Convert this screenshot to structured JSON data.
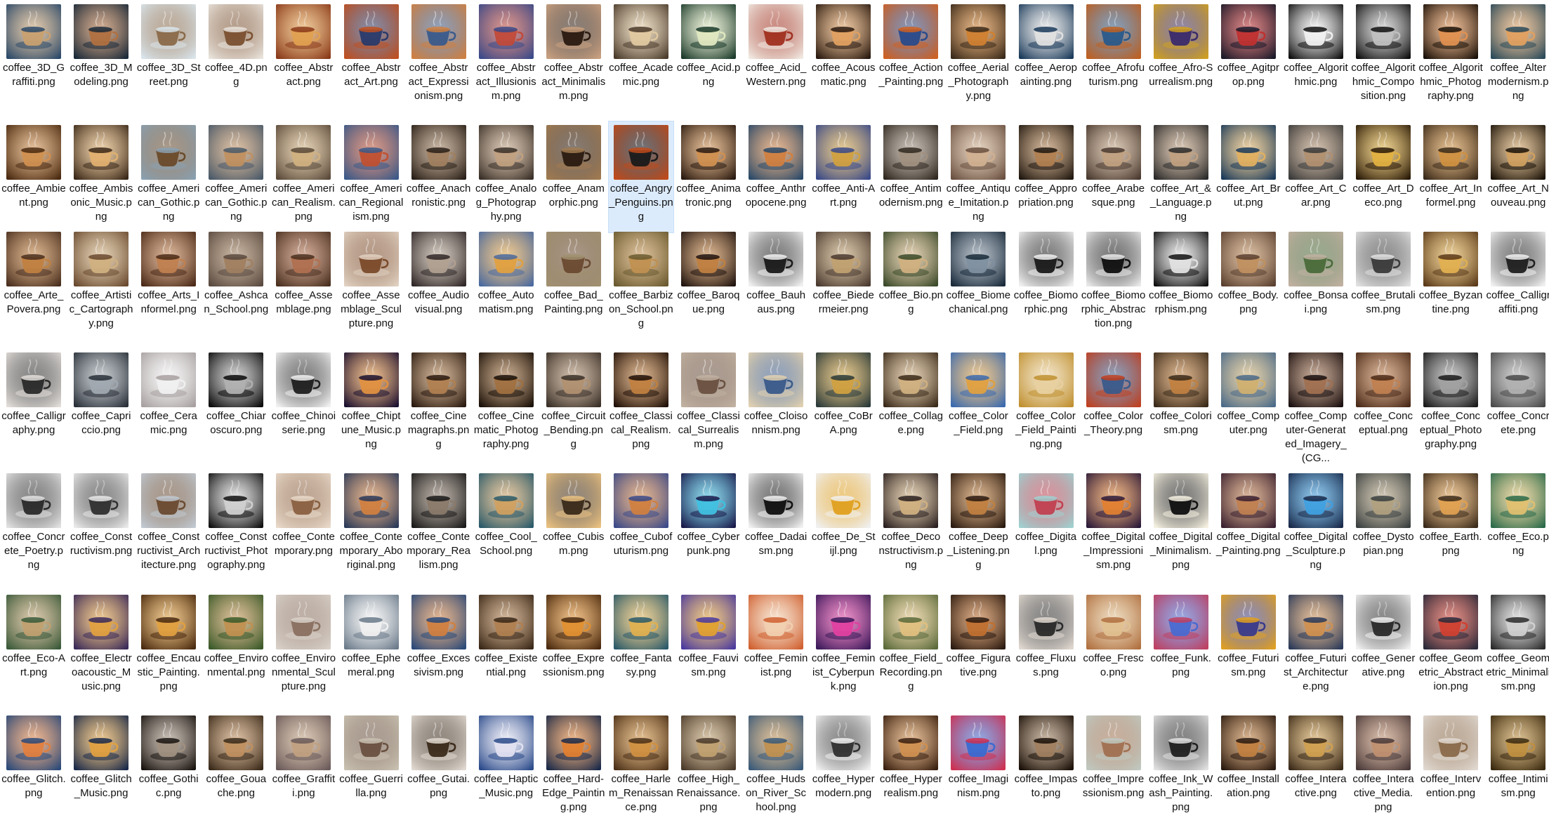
{
  "files": [
    {
      "name": "coffee_3D_Graffiti.png",
      "colors": [
        "#2b4a6a",
        "#c8a070"
      ]
    },
    {
      "name": "coffee_3D_Modeling.png",
      "colors": [
        "#1a2a3a",
        "#b07040"
      ]
    },
    {
      "name": "coffee_3D_Street.png",
      "colors": [
        "#d9e4ea",
        "#8a6a4a"
      ]
    },
    {
      "name": "coffee_4D.png",
      "colors": [
        "#e8e2da",
        "#7a5030"
      ]
    },
    {
      "name": "coffee_Abstract.png",
      "colors": [
        "#8a3a1a",
        "#e0a050"
      ]
    },
    {
      "name": "coffee_Abstract_Art.png",
      "colors": [
        "#c05020",
        "#2a3a6a"
      ]
    },
    {
      "name": "coffee_Abstract_Expressionism.png",
      "colors": [
        "#d08040",
        "#3a5a8a"
      ]
    },
    {
      "name": "coffee_Abstract_Illusionism.png",
      "colors": [
        "#3a4a8a",
        "#c04a3a"
      ]
    },
    {
      "name": "coffee_Abstract_Minimalism.png",
      "colors": [
        "#c8a080",
        "#2a1a10"
      ]
    },
    {
      "name": "coffee_Academic.png",
      "colors": [
        "#4a3a2a",
        "#e0c8a0"
      ]
    },
    {
      "name": "coffee_Acid.png",
      "colors": [
        "#1a3a2a",
        "#e0e8c0"
      ]
    },
    {
      "name": "coffee_Acid_Western.png",
      "colors": [
        "#f0e8e0",
        "#a03020"
      ]
    },
    {
      "name": "coffee_Acousmatic.png",
      "colors": [
        "#2a1a10",
        "#e0a060"
      ]
    },
    {
      "name": "coffee_Action_Painting.png",
      "colors": [
        "#d06020",
        "#2a4a8a"
      ]
    },
    {
      "name": "coffee_Aerial_Photography.png",
      "colors": [
        "#3a2a1a",
        "#d08030"
      ]
    },
    {
      "name": "coffee_Aeropainting.png",
      "colors": [
        "#1a3a5a",
        "#e0e0e0"
      ]
    },
    {
      "name": "coffee_Afrofuturism.png",
      "colors": [
        "#c06020",
        "#2a5a8a"
      ]
    },
    {
      "name": "coffee_Afro-Surrealism.png",
      "colors": [
        "#d0a020",
        "#3a2a6a"
      ]
    },
    {
      "name": "coffee_Agitprop.png",
      "colors": [
        "#1a1a2a",
        "#c03030"
      ]
    },
    {
      "name": "coffee_Algorithmic.png",
      "colors": [
        "#101010",
        "#f0f0f0"
      ]
    },
    {
      "name": "coffee_Algorithmic_Composition.png",
      "colors": [
        "#101010",
        "#c0c0c0"
      ]
    },
    {
      "name": "coffee_Algorithmic_Photography.png",
      "colors": [
        "#1a1008",
        "#e09050"
      ]
    },
    {
      "name": "coffee_Altermodernism.png",
      "colors": [
        "#2a4a5a",
        "#e0a060"
      ]
    },
    {
      "name": "coffee_Ambient.png",
      "colors": [
        "#4a2a10",
        "#d09050"
      ]
    },
    {
      "name": "coffee_Ambisonic_Music.png",
      "colors": [
        "#3a2818",
        "#e0b070"
      ]
    },
    {
      "name": "coffee_American_Gothic.png",
      "colors": [
        "#8aa0b0",
        "#6a4a2a"
      ]
    },
    {
      "name": "coffee_American_Gothic.png",
      "colors": [
        "#4a5a6a",
        "#c09060"
      ]
    },
    {
      "name": "coffee_American_Realism.png",
      "colors": [
        "#5a4a3a",
        "#d0b080"
      ]
    },
    {
      "name": "coffee_American_Regionalism.png",
      "colors": [
        "#3a5a8a",
        "#c05030"
      ]
    },
    {
      "name": "coffee_Anachronistic.png",
      "colors": [
        "#2a2018",
        "#a08060"
      ]
    },
    {
      "name": "coffee_Analog_Photography.png",
      "colors": [
        "#3a3028",
        "#c0a080"
      ]
    },
    {
      "name": "coffee_Anamorphic.png",
      "colors": [
        "#a07a50",
        "#2a1a10"
      ]
    },
    {
      "name": "coffee_Angry_Penguins.png",
      "colors": [
        "#c04a1a",
        "#1a1a1a"
      ]
    },
    {
      "name": "coffee_Animatronic.png",
      "colors": [
        "#2a1a10",
        "#d09050"
      ]
    },
    {
      "name": "coffee_Anthropocene.png",
      "colors": [
        "#2a4a6a",
        "#d08040"
      ]
    },
    {
      "name": "coffee_Anti-Art.png",
      "colors": [
        "#3a4a8a",
        "#d0a040"
      ]
    },
    {
      "name": "coffee_Antimodernism.png",
      "colors": [
        "#302820",
        "#a09080"
      ]
    },
    {
      "name": "coffee_Antique_Imitation.png",
      "colors": [
        "#6a5040",
        "#d0b090"
      ]
    },
    {
      "name": "coffee_Appropriation.png",
      "colors": [
        "#201810",
        "#b08050"
      ]
    },
    {
      "name": "coffee_Arabesque.png",
      "colors": [
        "#4a3a30",
        "#c0a080"
      ]
    },
    {
      "name": "coffee_Art_&_Language.png",
      "colors": [
        "#2a2a2a",
        "#c0a080"
      ]
    },
    {
      "name": "coffee_Art_Brut.png",
      "colors": [
        "#1a3a5a",
        "#e0b060"
      ]
    },
    {
      "name": "coffee_Art_Car.png",
      "colors": [
        "#3a3a3a",
        "#b09070"
      ]
    },
    {
      "name": "coffee_Art_Deco.png",
      "colors": [
        "#2a1a08",
        "#e0b040"
      ]
    },
    {
      "name": "coffee_Art_Informel.png",
      "colors": [
        "#3a2a1a",
        "#d09040"
      ]
    },
    {
      "name": "coffee_Art_Nouveau.png",
      "colors": [
        "#1a1208",
        "#d0a060"
      ]
    },
    {
      "name": "coffee_Arte_Povera.png",
      "colors": [
        "#4a3020",
        "#c08040"
      ]
    },
    {
      "name": "coffee_Artistic_Cartography.png",
      "colors": [
        "#6a4a30",
        "#d0b080"
      ]
    },
    {
      "name": "coffee_Arts_Informel.png",
      "colors": [
        "#4a2a18",
        "#c08050"
      ]
    },
    {
      "name": "coffee_Ashcan_School.png",
      "colors": [
        "#5a4a40",
        "#a08060"
      ]
    },
    {
      "name": "coffee_Assemblage.png",
      "colors": [
        "#4a3020",
        "#b07050"
      ]
    },
    {
      "name": "coffee_Assemblage_Sculpture.png",
      "colors": [
        "#e0d0c0",
        "#7a4a2a"
      ]
    },
    {
      "name": "coffee_Audiovisual.png",
      "colors": [
        "#302828",
        "#b0a090"
      ]
    },
    {
      "name": "coffee_Automatism.png",
      "colors": [
        "#4a6aa0",
        "#e0a040"
      ]
    },
    {
      "name": "coffee_Bad_Painting.png",
      "colors": [
        "#a09070",
        "#6a4a30"
      ]
    },
    {
      "name": "coffee_Barbizon_School.png",
      "colors": [
        "#6a5a30",
        "#c09050"
      ]
    },
    {
      "name": "coffee_Baroque.png",
      "colors": [
        "#201410",
        "#c08040"
      ]
    },
    {
      "name": "coffee_Bauhaus.png",
      "colors": [
        "#f0f0f0",
        "#1a1a1a"
      ]
    },
    {
      "name": "coffee_Biedermeier.png",
      "colors": [
        "#4a3a30",
        "#c0a070"
      ]
    },
    {
      "name": "coffee_Bio.png",
      "colors": [
        "#3a4a2a",
        "#d0b080"
      ]
    },
    {
      "name": "coffee_Biomechanical.png",
      "colors": [
        "#1a2a3a",
        "#8090a0"
      ]
    },
    {
      "name": "coffee_Biomorphic.png",
      "colors": [
        "#f0f0f0",
        "#1a1a1a"
      ]
    },
    {
      "name": "coffee_Biomorphic_Abstraction.png",
      "colors": [
        "#e8e8e8",
        "#101010"
      ]
    },
    {
      "name": "coffee_Biomorphism.png",
      "colors": [
        "#101010",
        "#e0e0e0"
      ]
    },
    {
      "name": "coffee_Body.png",
      "colors": [
        "#5a4030",
        "#c09060"
      ]
    },
    {
      "name": "coffee_Bonsai.png",
      "colors": [
        "#c0b0a0",
        "#4a6a3a"
      ]
    },
    {
      "name": "coffee_Brutalism.png",
      "colors": [
        "#e0e0e0",
        "#3a3a3a"
      ]
    },
    {
      "name": "coffee_Byzantine.png",
      "colors": [
        "#5a3a1a",
        "#e0b050"
      ]
    },
    {
      "name": "coffee_Calligraffiti.png",
      "colors": [
        "#f0f0f0",
        "#202020"
      ]
    },
    {
      "name": "coffee_Calligraphy.png",
      "colors": [
        "#e0dcd8",
        "#2a2a2a"
      ]
    },
    {
      "name": "coffee_Capriccio.png",
      "colors": [
        "#2a3038",
        "#a0a8b0"
      ]
    },
    {
      "name": "coffee_Ceramic.png",
      "colors": [
        "#a8a0a0",
        "#f0f0f0"
      ]
    },
    {
      "name": "coffee_Chiaroscuro.png",
      "colors": [
        "#0a0a0a",
        "#b0b0b0"
      ]
    },
    {
      "name": "coffee_Chinoiserie.png",
      "colors": [
        "#f0f0f0",
        "#202020"
      ]
    },
    {
      "name": "coffee_Chiptune_Music.png",
      "colors": [
        "#1a1030",
        "#e09040"
      ]
    },
    {
      "name": "coffee_Cinemagraphs.png",
      "colors": [
        "#2a1a10",
        "#b08050"
      ]
    },
    {
      "name": "coffee_Cinematic_Photography.png",
      "colors": [
        "#1a1008",
        "#a07040"
      ]
    },
    {
      "name": "coffee_Circuit_Bending.png",
      "colors": [
        "#3a3028",
        "#b09070"
      ]
    },
    {
      "name": "coffee_Classical_Realism.png",
      "colors": [
        "#201008",
        "#c08040"
      ]
    },
    {
      "name": "coffee_Classical_Surrealism.png",
      "colors": [
        "#c0b0a0",
        "#6a5040"
      ]
    },
    {
      "name": "coffee_Cloisonnism.png",
      "colors": [
        "#e0d0b0",
        "#3a5a8a"
      ]
    },
    {
      "name": "coffee_CoBrA.png",
      "colors": [
        "#2a3a3a",
        "#d0a040"
      ]
    },
    {
      "name": "coffee_Collage.png",
      "colors": [
        "#3a2a1a",
        "#d0b080"
      ]
    },
    {
      "name": "coffee_Color_Field.png",
      "colors": [
        "#3a6ab0",
        "#e0a040"
      ]
    },
    {
      "name": "coffee_Color_Field_Painting.png",
      "colors": [
        "#c09030",
        "#e8d0a0"
      ]
    },
    {
      "name": "coffee_Color_Theory.png",
      "colors": [
        "#c04020",
        "#3a5a8a"
      ]
    },
    {
      "name": "coffee_Colorism.png",
      "colors": [
        "#3a2a1a",
        "#c08040"
      ]
    },
    {
      "name": "coffee_Computer.png",
      "colors": [
        "#4a6a8a",
        "#d0b070"
      ]
    },
    {
      "name": "coffee_Computer-Generated_Imagery_(CG...",
      "colors": [
        "#1a1010",
        "#a07050"
      ]
    },
    {
      "name": "coffee_Conceptual.png",
      "colors": [
        "#4a2a18",
        "#c08050"
      ]
    },
    {
      "name": "coffee_Conceptual_Photography.png",
      "colors": [
        "#1a1a1a",
        "#a0a0a0"
      ]
    },
    {
      "name": "coffee_Concrete.png",
      "colors": [
        "#4a4a4a",
        "#b0b0b0"
      ]
    },
    {
      "name": "coffee_Concrete_Poetry.png",
      "colors": [
        "#e0e0e0",
        "#2a2a2a"
      ]
    },
    {
      "name": "coffee_Constructivism.png",
      "colors": [
        "#e8e8e8",
        "#303030"
      ]
    },
    {
      "name": "coffee_Constructivist_Architecture.png",
      "colors": [
        "#c0c8d0",
        "#6a4a30"
      ]
    },
    {
      "name": "coffee_Constructivist_Photography.png",
      "colors": [
        "#101010",
        "#d0d0d0"
      ]
    },
    {
      "name": "coffee_Contemporary.png",
      "colors": [
        "#e8d8c8",
        "#8a6040"
      ]
    },
    {
      "name": "coffee_Contemporary_Aboriginal.png",
      "colors": [
        "#2a3a5a",
        "#d08040"
      ]
    },
    {
      "name": "coffee_Contemporary_Realism.png",
      "colors": [
        "#1a1a1a",
        "#8a7a6a"
      ]
    },
    {
      "name": "coffee_Cool_School.png",
      "colors": [
        "#2a5a6a",
        "#d0a060"
      ]
    },
    {
      "name": "coffee_Cubism.png",
      "colors": [
        "#e8c080",
        "#3a2a1a"
      ]
    },
    {
      "name": "coffee_Cubofuturism.png",
      "colors": [
        "#3a4a8a",
        "#d08040"
      ]
    },
    {
      "name": "coffee_Cyberpunk.png",
      "colors": [
        "#1a1a4a",
        "#40c0e0"
      ]
    },
    {
      "name": "coffee_Dadaism.png",
      "colors": [
        "#f0f0f0",
        "#101010"
      ]
    },
    {
      "name": "coffee_De_Stijl.png",
      "colors": [
        "#f0f0f0",
        "#e0a020"
      ]
    },
    {
      "name": "coffee_Deconstructivism.png",
      "colors": [
        "#2a2020",
        "#d0b080"
      ]
    },
    {
      "name": "coffee_Deep_Listening.png",
      "colors": [
        "#2a1a10",
        "#c08040"
      ]
    },
    {
      "name": "coffee_Digital.png",
      "colors": [
        "#a0d0d0",
        "#c04050"
      ]
    },
    {
      "name": "coffee_Digital_Impressionism.png",
      "colors": [
        "#2a1a3a",
        "#e08030"
      ]
    },
    {
      "name": "coffee_Digital_Minimalism.png",
      "colors": [
        "#f5f0e0",
        "#101010"
      ]
    },
    {
      "name": "coffee_Digital_Painting.png",
      "colors": [
        "#3a2030",
        "#c08050"
      ]
    },
    {
      "name": "coffee_Digital_Sculpture.png",
      "colors": [
        "#1a2a4a",
        "#40a0e0"
      ]
    },
    {
      "name": "coffee_Dystopian.png",
      "colors": [
        "#3a4040",
        "#b0a080"
      ]
    },
    {
      "name": "coffee_Earth.png",
      "colors": [
        "#3a2a1a",
        "#e0a050"
      ]
    },
    {
      "name": "coffee_Eco.png",
      "colors": [
        "#2a6a4a",
        "#e0c070"
      ]
    },
    {
      "name": "coffee_Eco-Art.png",
      "colors": [
        "#3a5a3a",
        "#c0a070"
      ]
    },
    {
      "name": "coffee_Electroacoustic_Music.png",
      "colors": [
        "#3a2a5a",
        "#e0a040"
      ]
    },
    {
      "name": "coffee_Encaustic_Painting.png",
      "colors": [
        "#4a2a10",
        "#e0a040"
      ]
    },
    {
      "name": "coffee_Environmental.png",
      "colors": [
        "#3a5a2a",
        "#c09050"
      ]
    },
    {
      "name": "coffee_Environmental_Sculpture.png",
      "colors": [
        "#d8d0c8",
        "#8a7060"
      ]
    },
    {
      "name": "coffee_Ephemeral.png",
      "colors": [
        "#6a7a8a",
        "#f0f0f0"
      ]
    },
    {
      "name": "coffee_Excessivism.png",
      "colors": [
        "#2a4a7a",
        "#d08040"
      ]
    },
    {
      "name": "coffee_Existential.png",
      "colors": [
        "#3a2818",
        "#b08050"
      ]
    },
    {
      "name": "coffee_Expressionism.png",
      "colors": [
        "#4a2a10",
        "#e09030"
      ]
    },
    {
      "name": "coffee_Fantasy.png",
      "colors": [
        "#2a5a6a",
        "#e0b050"
      ]
    },
    {
      "name": "coffee_Fauvism.png",
      "colors": [
        "#4a3aa0",
        "#e0a030"
      ]
    },
    {
      "name": "coffee_Feminist.png",
      "colors": [
        "#d06030",
        "#f0d0b0"
      ]
    },
    {
      "name": "coffee_Feminist_Cyberpunk.png",
      "colors": [
        "#3a1a5a",
        "#e040a0"
      ]
    },
    {
      "name": "coffee_Field_Recording.png",
      "colors": [
        "#5a6a3a",
        "#e0c080"
      ]
    },
    {
      "name": "coffee_Figurative.png",
      "colors": [
        "#2a1a10",
        "#c07030"
      ]
    },
    {
      "name": "coffee_Fluxus.png",
      "colors": [
        "#e0d8d0",
        "#2a2a2a"
      ]
    },
    {
      "name": "coffee_Fresco.png",
      "colors": [
        "#b07040",
        "#e0c090"
      ]
    },
    {
      "name": "coffee_Funk.png",
      "colors": [
        "#c04060",
        "#4a6ad0"
      ]
    },
    {
      "name": "coffee_Futurism.png",
      "colors": [
        "#e0a020",
        "#3a3a8a"
      ]
    },
    {
      "name": "coffee_Futurist_Architecture.png",
      "colors": [
        "#2a3a5a",
        "#d09050"
      ]
    },
    {
      "name": "coffee_Generative.png",
      "colors": [
        "#f0f0f0",
        "#2a2a2a"
      ]
    },
    {
      "name": "coffee_Geometric_Abstraction.png",
      "colors": [
        "#2a2a3a",
        "#d04030"
      ]
    },
    {
      "name": "coffee_Geometric_Minimalism.png",
      "colors": [
        "#2a2a2a",
        "#d0d0d0"
      ]
    },
    {
      "name": "coffee_Glitch.png",
      "colors": [
        "#2a4a7a",
        "#e08040"
      ]
    },
    {
      "name": "coffee_Glitch_Music.png",
      "colors": [
        "#1a2a4a",
        "#e0a040"
      ]
    },
    {
      "name": "coffee_Gothic.png",
      "colors": [
        "#1a1410",
        "#a09080"
      ]
    },
    {
      "name": "coffee_Gouache.png",
      "colors": [
        "#3a2a1a",
        "#c09060"
      ]
    },
    {
      "name": "coffee_Graffiti.png",
      "colors": [
        "#6a5a5a",
        "#c0a080"
      ]
    },
    {
      "name": "coffee_Guerrilla.png",
      "colors": [
        "#c8c0b0",
        "#6a5040"
      ]
    },
    {
      "name": "coffee_Gutai.png",
      "colors": [
        "#e0d8d0",
        "#3a2a1a"
      ]
    },
    {
      "name": "coffee_Haptic_Music.png",
      "colors": [
        "#2a4a8a",
        "#e0e0f0"
      ]
    },
    {
      "name": "coffee_Hard-Edge_Painting.png",
      "colors": [
        "#1a2a4a",
        "#e08030"
      ]
    },
    {
      "name": "coffee_Harlem_Renaissance.png",
      "colors": [
        "#4a3018",
        "#d09040"
      ]
    },
    {
      "name": "coffee_High_Renaissance.png",
      "colors": [
        "#4a3a2a",
        "#c0a070"
      ]
    },
    {
      "name": "coffee_Hudson_River_School.png",
      "colors": [
        "#3a5a7a",
        "#c09050"
      ]
    },
    {
      "name": "coffee_Hypermodern.png",
      "colors": [
        "#f0f0f0",
        "#303030"
      ]
    },
    {
      "name": "coffee_Hyperrealism.png",
      "colors": [
        "#3a2010",
        "#d09050"
      ]
    },
    {
      "name": "coffee_Imaginism.png",
      "colors": [
        "#d03050",
        "#3a6ad0"
      ]
    },
    {
      "name": "coffee_Impasto.png",
      "colors": [
        "#1a1008",
        "#a08060"
      ]
    },
    {
      "name": "coffee_Impressionism.png",
      "colors": [
        "#c0c8c0",
        "#a07050"
      ]
    },
    {
      "name": "coffee_Ink_Wash_Painting.png",
      "colors": [
        "#e0e0e0",
        "#202020"
      ]
    },
    {
      "name": "coffee_Installation.png",
      "colors": [
        "#2a1a10",
        "#c08040"
      ]
    },
    {
      "name": "coffee_Interactive.png",
      "colors": [
        "#3a2a1a",
        "#d0a050"
      ]
    },
    {
      "name": "coffee_Interactive_Media.png",
      "colors": [
        "#4a3a3a",
        "#c09070"
      ]
    },
    {
      "name": "coffee_Intervention.png",
      "colors": [
        "#e0d8d0",
        "#8a6a4a"
      ]
    },
    {
      "name": "coffee_Intimism.png",
      "colors": [
        "#3a2a10",
        "#c09040"
      ]
    }
  ],
  "selected_index": 32
}
